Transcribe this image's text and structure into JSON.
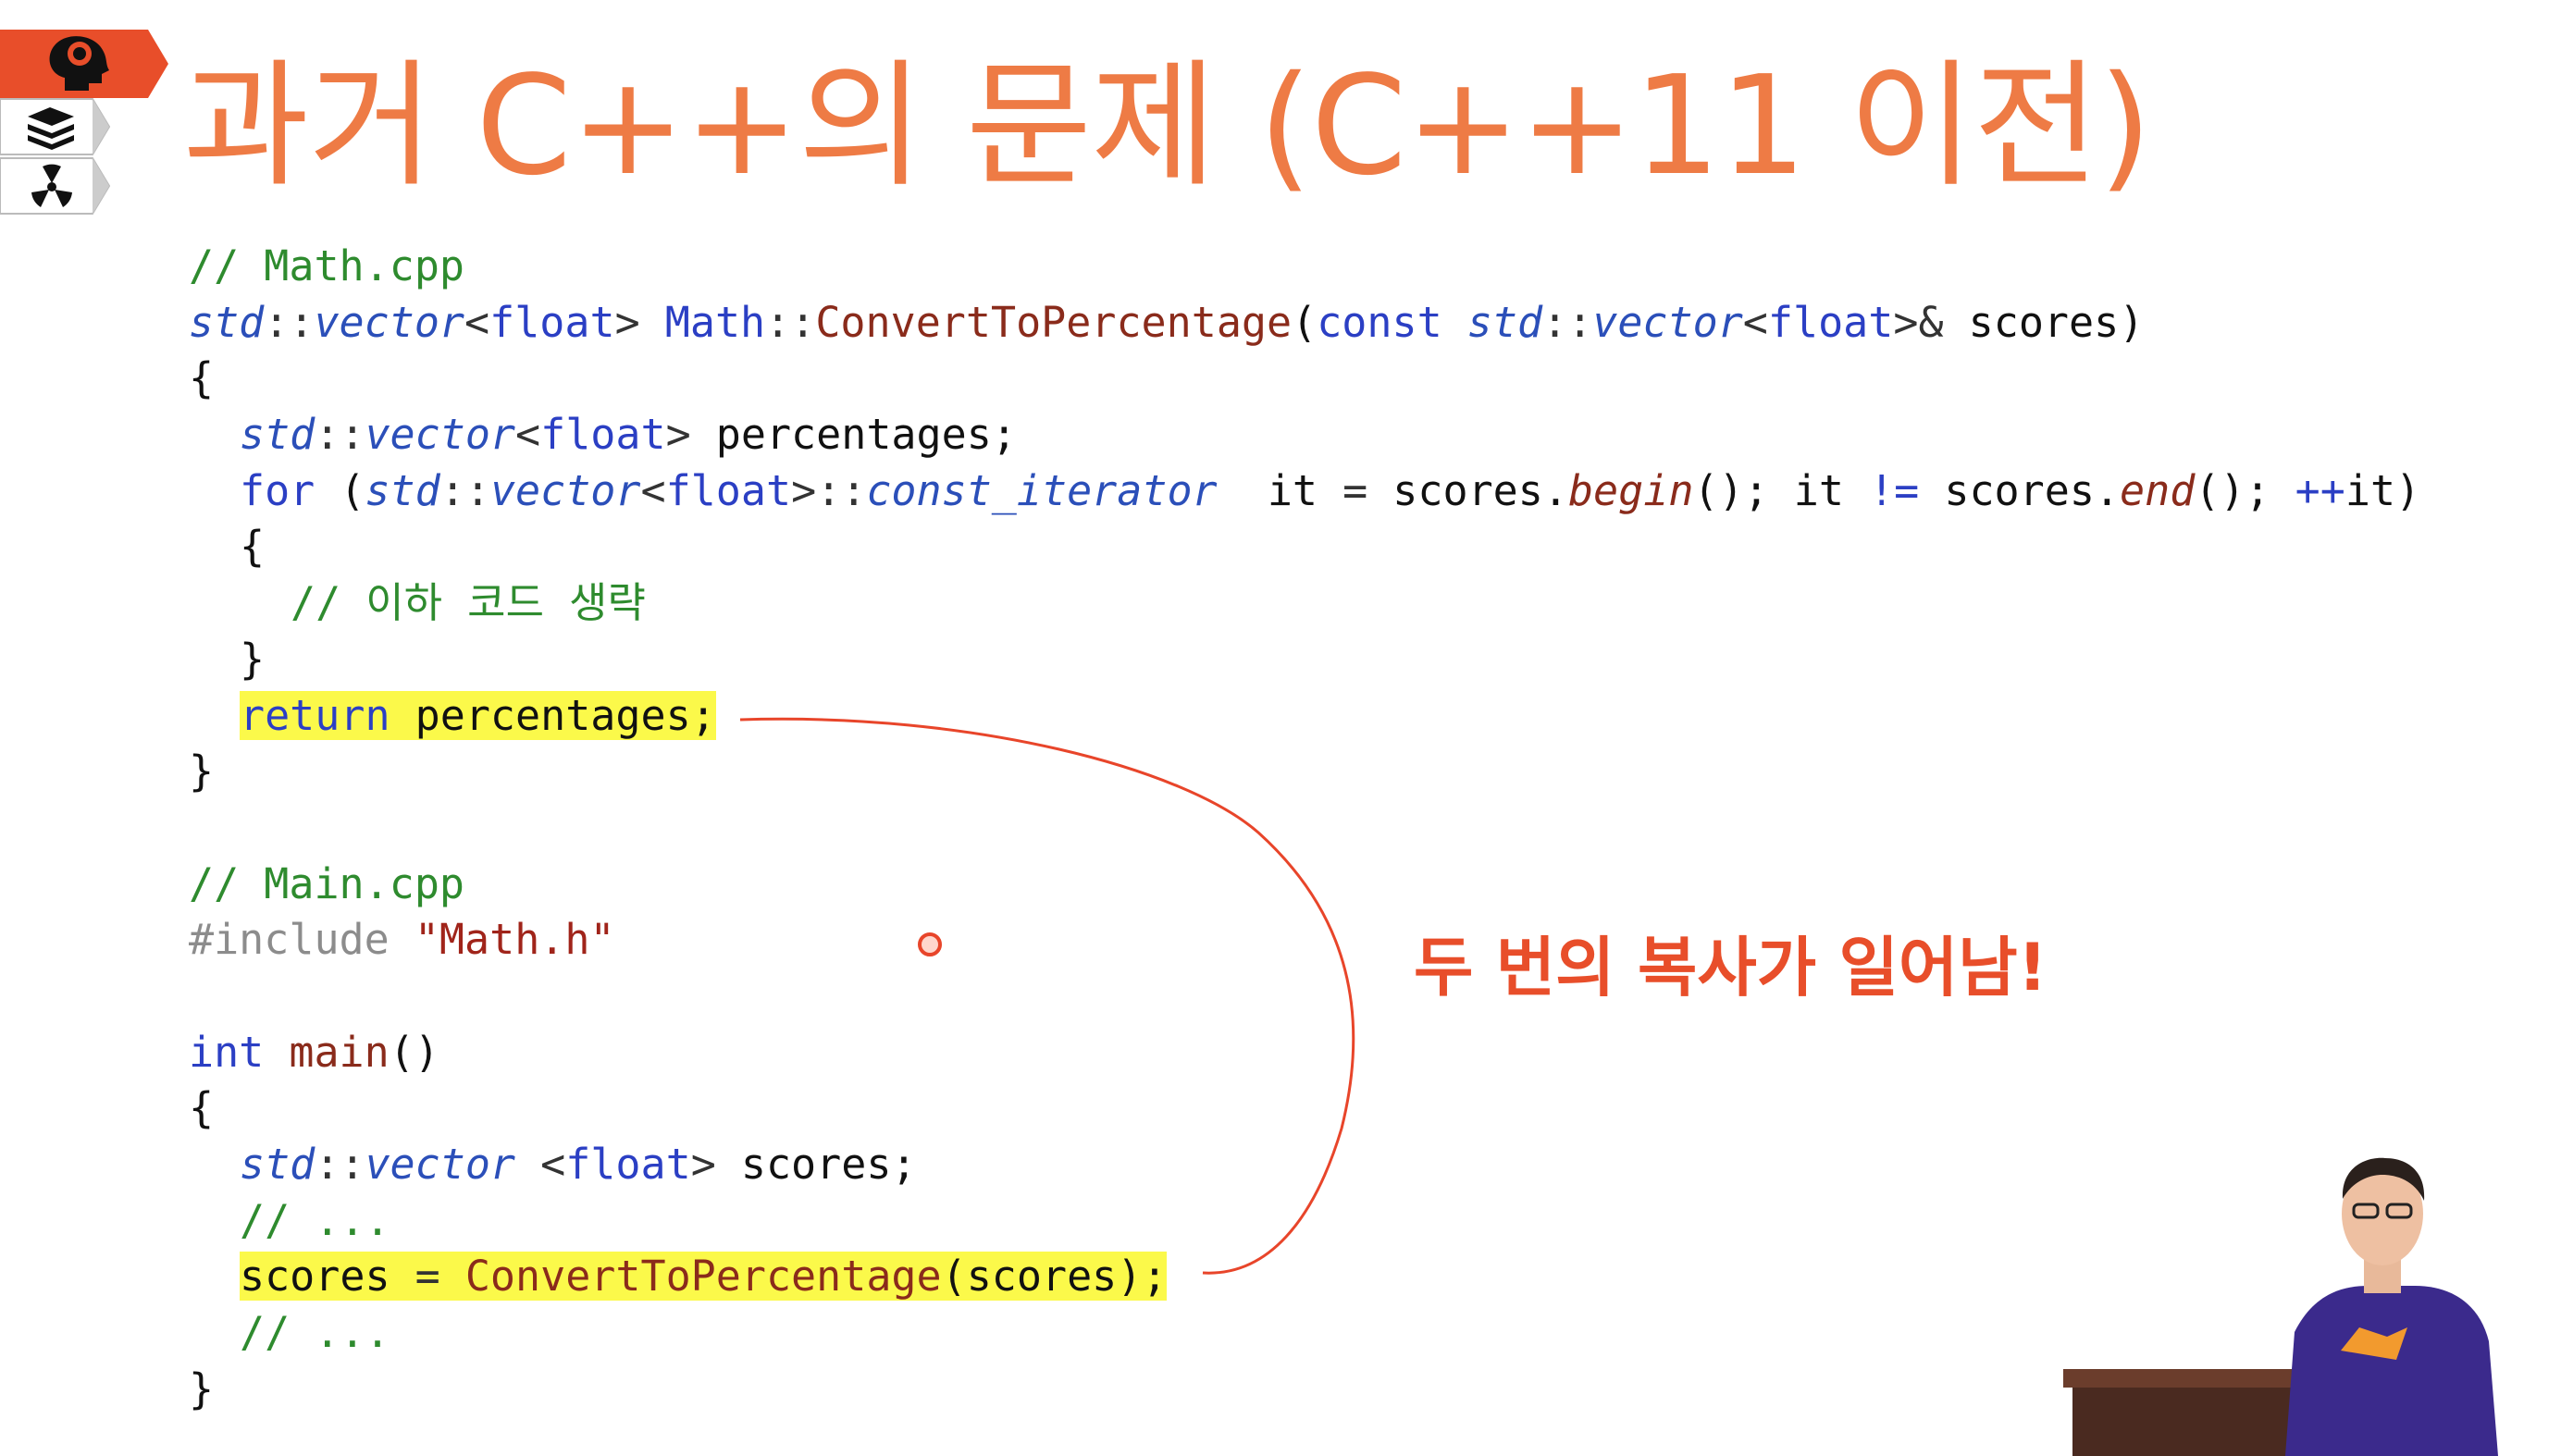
{
  "slide": {
    "title": "과거 C++의 문제 (C++11 이전)",
    "badges": [
      {
        "icon": "brain-head-icon",
        "color": "#e84e2a",
        "active": true
      },
      {
        "icon": "books-stack-icon",
        "color": "#ffffff",
        "active": false
      },
      {
        "icon": "radiation-icon",
        "color": "#ffffff",
        "active": false
      }
    ],
    "annotation": "두 번의 복사가 일어남!",
    "colors": {
      "title": "#ee7b45",
      "annotation": "#e84e2a",
      "highlight": "#fbf94a",
      "comment": "#2e8b2e",
      "type": "#2b4fb9",
      "function": "#8a2b1b"
    }
  },
  "code": {
    "math_comment": "// Math.cpp",
    "sig_std": "std",
    "sig_vector": "vector",
    "sig_float": "float",
    "sig_class": "Math",
    "sig_fn": "ConvertToPercentage",
    "sig_const": "const",
    "sig_std2": "std",
    "sig_vector2": "vector",
    "sig_float2": "float",
    "sig_param": "scores",
    "open_brace": "{",
    "decl_std": "std",
    "decl_vector": "vector",
    "decl_float": "float",
    "decl_var": "percentages;",
    "for_kw": "for",
    "for_std": "std",
    "for_vector": "vector",
    "for_float": "float",
    "for_iter": "const_iterator",
    "for_it": "it",
    "for_scores": "scores",
    "for_begin": "begin",
    "for_it2": "it",
    "for_ne": "!=",
    "for_scores2": "scores",
    "for_end": "end",
    "for_inc": "++",
    "for_it3": "it",
    "inner_open": "{",
    "inner_comment": "// 이하 코드 생략",
    "inner_close": "}",
    "return_kw": "return",
    "return_val": "percentages;",
    "close_brace": "}",
    "main_comment": "// Main.cpp",
    "include_kw": "#include",
    "include_file": "\"Math.h\"",
    "int_kw": "int",
    "main_fn": "main",
    "main_open": "{",
    "m_std": "std",
    "m_vector": "vector",
    "m_float": "float",
    "m_var": "scores;",
    "m_comment1": "// ...",
    "m_assign_var": "scores",
    "m_eq": "=",
    "m_call": "ConvertToPercentage",
    "m_arg": "(scores);",
    "m_comment2": "// ...",
    "main_close": "}"
  }
}
